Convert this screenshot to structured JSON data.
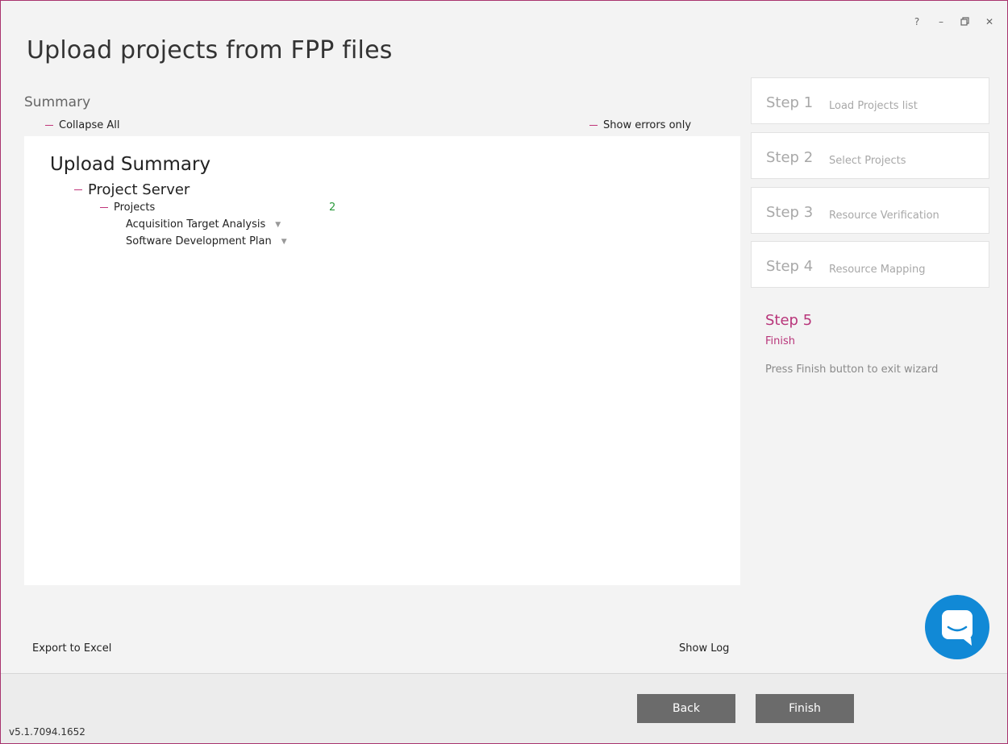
{
  "window": {
    "title": "Upload projects from FPP files",
    "controls": {
      "help": "?",
      "minimize": "–",
      "close": "✕"
    }
  },
  "summary": {
    "heading": "Summary",
    "collapse_all_label": "Collapse All",
    "show_errors_label": "Show errors only",
    "tree": {
      "title": "Upload Summary",
      "server_label": "Project Server",
      "projects_label": "Projects",
      "projects_count": "2",
      "projects": [
        {
          "name": "Acquisition Target Analysis"
        },
        {
          "name": "Software Development Plan"
        }
      ]
    }
  },
  "steps": [
    {
      "number": "Step 1",
      "name": "Load Projects list"
    },
    {
      "number": "Step 2",
      "name": "Select Projects"
    },
    {
      "number": "Step 3",
      "name": "Resource Verification"
    },
    {
      "number": "Step 4",
      "name": "Resource Mapping"
    }
  ],
  "current_step": {
    "number": "Step 5",
    "name": "Finish",
    "description": "Press Finish button to exit wizard"
  },
  "links": {
    "export_label": "Export to Excel",
    "show_log_label": "Show Log"
  },
  "footer": {
    "back_label": "Back",
    "finish_label": "Finish",
    "version": "v5.1.7094.1652"
  },
  "colors": {
    "accent": "#c0357a",
    "count_green": "#2a9a3c",
    "chat_blue": "#1189d6",
    "button_gray": "#6b6b6b"
  },
  "icons": [
    "help-icon",
    "minimize-icon",
    "restore-icon",
    "close-icon",
    "dropdown-arrow-icon",
    "chat-icon"
  ]
}
